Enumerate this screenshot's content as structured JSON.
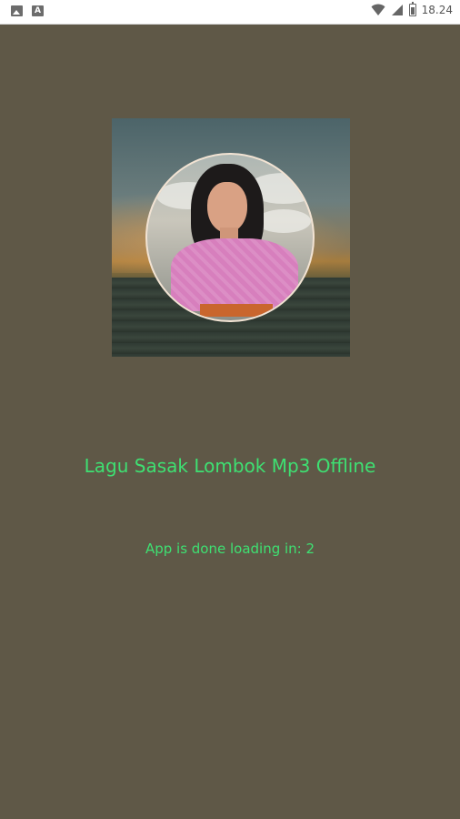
{
  "status_bar": {
    "time": "18.24",
    "left_icons": [
      "image-notification-icon",
      "a-notification-icon"
    ],
    "right_icons": [
      "wifi-icon",
      "signal-icon",
      "battery-icon"
    ]
  },
  "splash": {
    "image": "singer-portrait-image"
  },
  "app": {
    "title": "Lagu Sasak Lombok Mp3 Offline",
    "loading_message": "App is done loading in: 2"
  },
  "colors": {
    "background": "#5f5847",
    "text_accent": "#3ee072",
    "status_bar_bg": "#ffffff"
  }
}
